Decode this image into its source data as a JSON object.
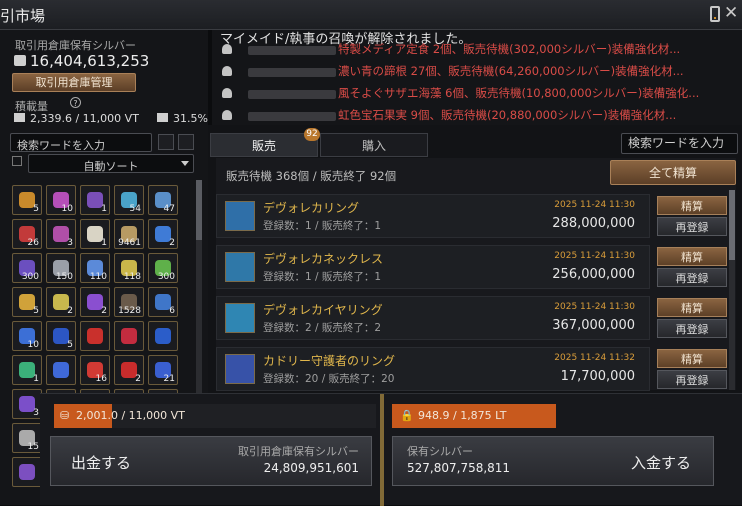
{
  "window": {
    "title": "引市場",
    "close_glyph": "✕"
  },
  "left": {
    "storage_label": "取引用倉庫保有シルバー",
    "storage_value": "16,404,613,253",
    "manage_button": "取引用倉庫管理",
    "load_label": "積載量",
    "load_value": "2,339.6 / 11,000 VT",
    "load_pct": "31.5%",
    "search_placeholder": "検索ワードを入力",
    "sort_label": "自動ソート",
    "inventory": [
      {
        "count": "5",
        "color": "#c98a2b"
      },
      {
        "count": "10",
        "color": "#b54fb8"
      },
      {
        "count": "1",
        "color": "#7a4fb8"
      },
      {
        "count": "54",
        "color": "#4aa3c9"
      },
      {
        "count": "47",
        "color": "#5a8fc9"
      },
      {
        "count": "26",
        "color": "#c23a3a"
      },
      {
        "count": "3",
        "color": "#b04fa8"
      },
      {
        "count": "1",
        "color": "#d9d4c5"
      },
      {
        "count": "9461",
        "color": "#b79a63"
      },
      {
        "count": "2",
        "color": "#3f7bd6"
      },
      {
        "count": "300",
        "color": "#6b4fbf"
      },
      {
        "count": "150",
        "color": "#9a9fa8"
      },
      {
        "count": "110",
        "color": "#5b8ad9"
      },
      {
        "count": "118",
        "color": "#c9b64a"
      },
      {
        "count": "300",
        "color": "#5fb04a"
      },
      {
        "count": "5",
        "color": "#d0a23a"
      },
      {
        "count": "2",
        "color": "#c8b84d"
      },
      {
        "count": "2",
        "color": "#8a4fd0"
      },
      {
        "count": "1528",
        "color": "#6a5a4a"
      },
      {
        "count": "6",
        "color": "#3f76c9"
      },
      {
        "count": "10",
        "color": "#3c6fd6"
      },
      {
        "count": "5",
        "color": "#2c56c4"
      },
      {
        "count": "",
        "color": "#c9302c"
      },
      {
        "count": "",
        "color": "#c32c3f"
      },
      {
        "count": "",
        "color": "#2b5dc9"
      },
      {
        "count": "1",
        "color": "#3bb07a"
      },
      {
        "count": "",
        "color": "#3f69d8"
      },
      {
        "count": "16",
        "color": "#d13a34"
      },
      {
        "count": "2",
        "color": "#c92c2c"
      },
      {
        "count": "21",
        "color": "#3a5fd0"
      },
      {
        "count": "3",
        "color": "#7b4fc9"
      },
      {
        "count": "",
        "color": "#3b64d3"
      },
      {
        "count": "",
        "color": "#c33838"
      },
      {
        "count": "",
        "color": "#c8952c"
      },
      {
        "count": "",
        "color": "#2c4fa8"
      },
      {
        "count": "15",
        "color": "#aaa"
      },
      {
        "count": "",
        "color": "#555"
      },
      {
        "count": "",
        "color": "#555"
      },
      {
        "count": "",
        "color": "#555"
      },
      {
        "count": "",
        "color": "#555"
      },
      {
        "count": "",
        "color": "#7c4fc0"
      },
      {
        "count": "",
        "color": "#555"
      },
      {
        "count": "",
        "color": "#555"
      },
      {
        "count": "",
        "color": "#555"
      },
      {
        "count": "",
        "color": "#555"
      }
    ]
  },
  "notices": {
    "header": "マイメイド/執事の召喚が解除されました。",
    "lines": [
      "特製メディア定食 2個、販売待機(302,000シルバー)装備強化材...",
      "濃い青の蹄根 27個、販売待機(64,260,000シルバー)装備強化材...",
      "風そよぐサザエ海藻 6個、販売待機(10,800,000シルバー)装備強化...",
      "虹色宝石果実 9個、販売待機(20,880,000シルバー)装備強化材..."
    ]
  },
  "tabs": {
    "sell": "販売",
    "buy": "購入",
    "sell_badge": "92"
  },
  "market_search_placeholder": "検索ワードを入力",
  "settle_all": "全て精算",
  "summary": "販売待機 368個 / 販売終了 92個",
  "listings": [
    {
      "name": "デヴォレカリング",
      "sub": "登録数：1 / 販売終了：1",
      "date": "2025 11-24 11:30",
      "price": "288,000,000",
      "icon": "#2f6fa8"
    },
    {
      "name": "デヴォレカネックレス",
      "sub": "登録数：1 / 販売終了：1",
      "date": "2025 11-24 11:30",
      "price": "256,000,000",
      "icon": "#2f78a8"
    },
    {
      "name": "デヴォレカイヤリング",
      "sub": "登録数：2 / 販売終了：2",
      "date": "2025 11-24 11:30",
      "price": "367,000,000",
      "icon": "#2f86b3"
    },
    {
      "name": "カドリー守護者のリング",
      "sub": "登録数：20 / 販売終了：20",
      "date": "2025 11-24 11:32",
      "price": "17,700,000",
      "icon": "#3752a8"
    }
  ],
  "buttons": {
    "settle": "精算",
    "reregister": "再登録"
  },
  "bottom": {
    "left_capacity": "2,001.0 / 11,000 VT",
    "withdraw": "出金する",
    "storage_label": "取引用倉庫保有シルバー",
    "storage_value": "24,809,951,601",
    "right_capacity": "948.9 / 1,875 LT",
    "silver_label": "保有シルバー",
    "silver_value": "527,807,758,811",
    "deposit": "入金する"
  },
  "colors": {
    "accent": "#c8591d",
    "gold": "#e1b74c",
    "notice_red": "#d94c47"
  }
}
